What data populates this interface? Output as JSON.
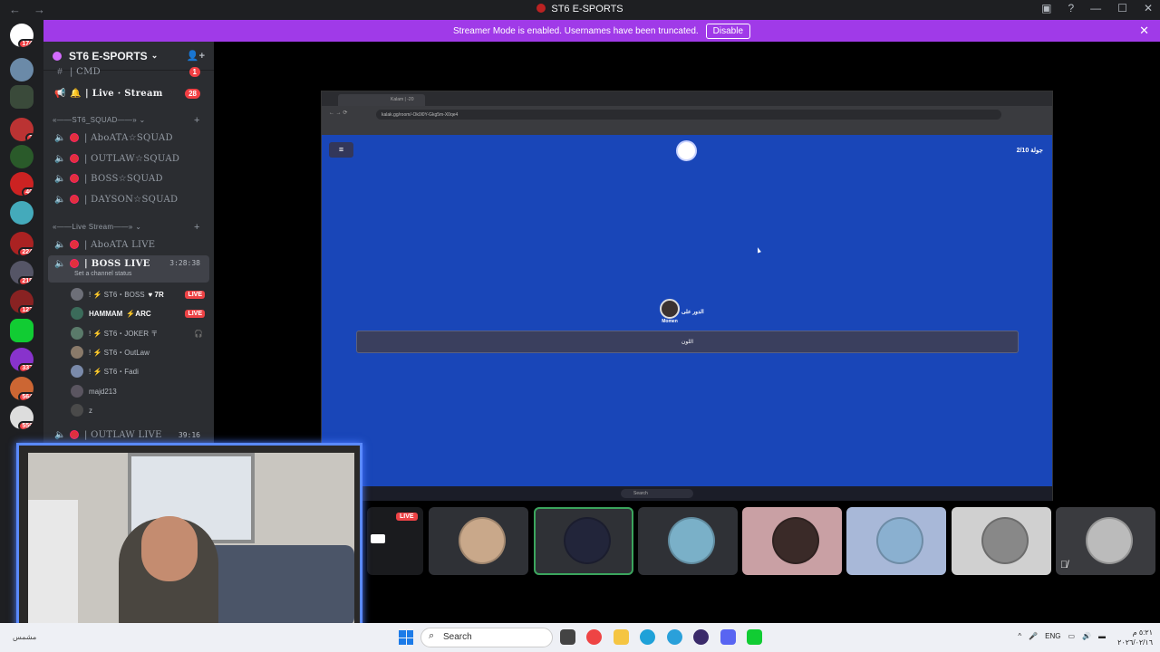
{
  "window": {
    "title": "ST6 E-SPORTS"
  },
  "banner": {
    "text": "Streamer Mode is enabled. Usernames have been truncated.",
    "disable_label": "Disable"
  },
  "server_rail": {
    "badges": [
      "174",
      "2",
      "40",
      "224",
      "218",
      "123",
      "337",
      "564",
      "556"
    ]
  },
  "guild": {
    "name": "ST6 E-SPORTS"
  },
  "channels": {
    "cmd": {
      "label": "| CMD",
      "badge": "1"
    },
    "live_stream": {
      "label": "| Live · Stream",
      "badge": "28"
    },
    "cat_squad": "«——ST6_SQUAD——»",
    "squad": [
      "| AboATA☆SQUAD",
      "| OUTLAW☆SQUAD",
      "| BOSS☆SQUAD",
      "| DAYSON☆SQUAD"
    ],
    "cat_live": "«——Live Stream——»",
    "abo_live": "| AboATA LIVE",
    "boss_live": {
      "label": "| BOSS LIVE",
      "timer": "3:28:38",
      "status": "Set a channel status"
    },
    "outlaw_live": {
      "label": "| OUTLAW LIVE",
      "timer": "39:16"
    }
  },
  "voice_users": [
    {
      "name": "! ⚡ ST6・BOSS",
      "tag": "♥ 7R",
      "live": "LIVE"
    },
    {
      "name": "HAMMAM",
      "tag": "⚡ARC",
      "live": "LIVE"
    },
    {
      "name": "! ⚡ ST6・JOKER 〒",
      "tag": "",
      "live": ""
    },
    {
      "name": "! ⚡ ST6・OutLaw",
      "tag": "",
      "live": ""
    },
    {
      "name": "! ⚡ ST6・Fadi",
      "tag": "",
      "live": ""
    },
    {
      "name": "majd213",
      "tag": "",
      "live": ""
    },
    {
      "name": "z",
      "tag": "",
      "live": ""
    }
  ],
  "stream": {
    "tab_title": "Kalam | -20",
    "url": "kalak.gg/room/-Ok0l0Y-Gkg5m-X0qe4",
    "round": "جولة 2/10",
    "turn_label": "الدور على",
    "player_name": "Momen",
    "bar_label": "اللون",
    "search_label": "Search"
  },
  "tiles": {
    "live_label": "LIVE"
  },
  "taskbar": {
    "search": "Search",
    "lang": "ENG",
    "time": "٥:٢١ م",
    "date": "٢٠٢٦/٠٢/١٦",
    "weather": "مشمس"
  },
  "colors": {
    "accent_banner": "#a03ae8",
    "game_bg": "#1946b8",
    "live_red": "#ed4245"
  }
}
